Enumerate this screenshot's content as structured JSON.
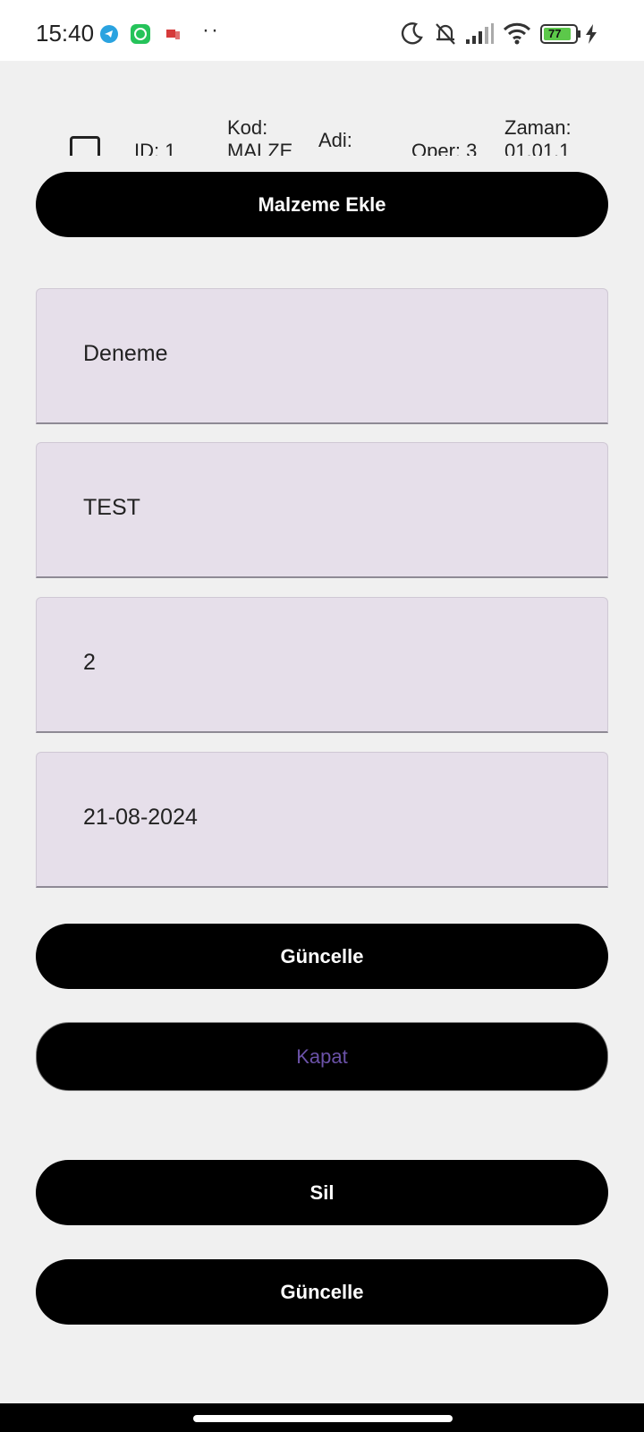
{
  "status_bar": {
    "time": "15:40",
    "icons": [
      "telegram-icon",
      "whatsapp-icon",
      "notification-flag-icon",
      "moon-icon",
      "bell-off-icon",
      "signal-icon",
      "wifi-icon",
      "battery-icon",
      "charging-icon"
    ],
    "battery_level": "77",
    "overflow": "··"
  },
  "list_row": {
    "id": "ID: 1",
    "kod_label": "Kod:",
    "kod_value": "MALZE",
    "adi_label": "Adi:",
    "oper": "Oper: 3",
    "zaman_label": "Zaman:",
    "zaman_value": "01.01.1"
  },
  "buttons": {
    "add_material": "Malzeme Ekle",
    "update": "Güncelle",
    "close": "Kapat",
    "delete": "Sil",
    "update_bottom": "Güncelle"
  },
  "fields": {
    "name": "Deneme",
    "code": "TEST",
    "operation": "2",
    "date": "21-08-2024"
  },
  "colors": {
    "background": "#f0f0f0",
    "button": "#000000",
    "field_fill": "#e6dfea",
    "close_text": "#6b52a8"
  }
}
